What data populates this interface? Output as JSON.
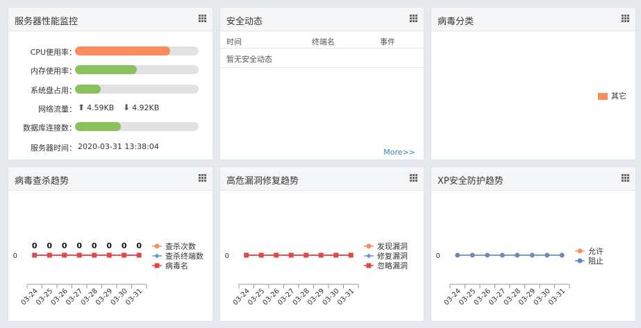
{
  "server": {
    "title": "服务器性能监控",
    "cpu_label": "CPU使用率：",
    "cpu_percent": 77,
    "mem_label": "内存使用率：",
    "mem_percent": 50,
    "disk_label": "系统盘占用：",
    "disk_percent": 21,
    "net_label": "网络流量：",
    "net_up": "4.59KB",
    "net_down": "4.92KB",
    "db_label": "数据库连接数：",
    "db_percent": 37,
    "time_label": "服务器时间：",
    "time_value": "2020-03-31 13:38:04",
    "colors": {
      "cpu": "#f98d5e",
      "normal": "#8bc15c",
      "track": "#e2e2e2"
    }
  },
  "security": {
    "title": "安全动态",
    "columns": [
      "时间",
      "终端名",
      "事件"
    ],
    "empty_text": "暂无安全动态",
    "more_label": "More>>"
  },
  "virus_class": {
    "title": "病毒分类",
    "legend": [
      {
        "label": "其它",
        "color": "#f98d5e"
      }
    ]
  },
  "chart_data": [
    {
      "type": "line",
      "title": "病毒查杀趋势",
      "categories": [
        "03-24",
        "03-25",
        "03-26",
        "03-27",
        "03-28",
        "03-29",
        "03-30",
        "03-31"
      ],
      "y_tick": "0",
      "data_labels": [
        "0",
        "0",
        "0",
        "0",
        "0",
        "0",
        "0",
        "0"
      ],
      "series": [
        {
          "name": "查杀次数",
          "values": [
            0,
            0,
            0,
            0,
            0,
            0,
            0,
            0
          ],
          "color": "#f98d5e",
          "marker": "circle"
        },
        {
          "name": "查杀终端数",
          "values": [
            0,
            0,
            0,
            0,
            0,
            0,
            0,
            0
          ],
          "color": "#5b9bd5",
          "marker": "diamond"
        },
        {
          "name": "病毒名",
          "values": [
            0,
            0,
            0,
            0,
            0,
            0,
            0,
            0
          ],
          "color": "#e04848",
          "marker": "square"
        }
      ],
      "visible_marker": "square",
      "visible_color": "#e04848"
    },
    {
      "type": "line",
      "title": "高危漏洞修复趋势",
      "categories": [
        "03-24",
        "03-25",
        "03-26",
        "03-27",
        "03-28",
        "03-29",
        "03-30",
        "03-31"
      ],
      "y_tick": "0",
      "data_labels": [],
      "series": [
        {
          "name": "发现漏洞",
          "values": [
            0,
            0,
            0,
            0,
            0,
            0,
            0,
            0
          ],
          "color": "#f98d5e",
          "marker": "circle"
        },
        {
          "name": "修复漏洞",
          "values": [
            0,
            0,
            0,
            0,
            0,
            0,
            0,
            0
          ],
          "color": "#5b9bd5",
          "marker": "diamond"
        },
        {
          "name": "忽略漏洞",
          "values": [
            0,
            0,
            0,
            0,
            0,
            0,
            0,
            0
          ],
          "color": "#e04848",
          "marker": "square"
        }
      ],
      "visible_marker": "square",
      "visible_color": "#e04848"
    },
    {
      "type": "line",
      "title": "XP安全防护趋势",
      "categories": [
        "03-24",
        "03-25",
        "03-26",
        "03-27",
        "03-28",
        "03-29",
        "03-30",
        "03-31"
      ],
      "y_tick": "0",
      "data_labels": [],
      "series": [
        {
          "name": "允许",
          "values": [
            0,
            0,
            0,
            0,
            0,
            0,
            0,
            0
          ],
          "color": "#f98d5e",
          "marker": "circle"
        },
        {
          "name": "阻止",
          "values": [
            0,
            0,
            0,
            0,
            0,
            0,
            0,
            0
          ],
          "color": "#5b86c2",
          "marker": "circle"
        }
      ],
      "visible_marker": "circle",
      "visible_color": "#6f8ab8"
    }
  ]
}
